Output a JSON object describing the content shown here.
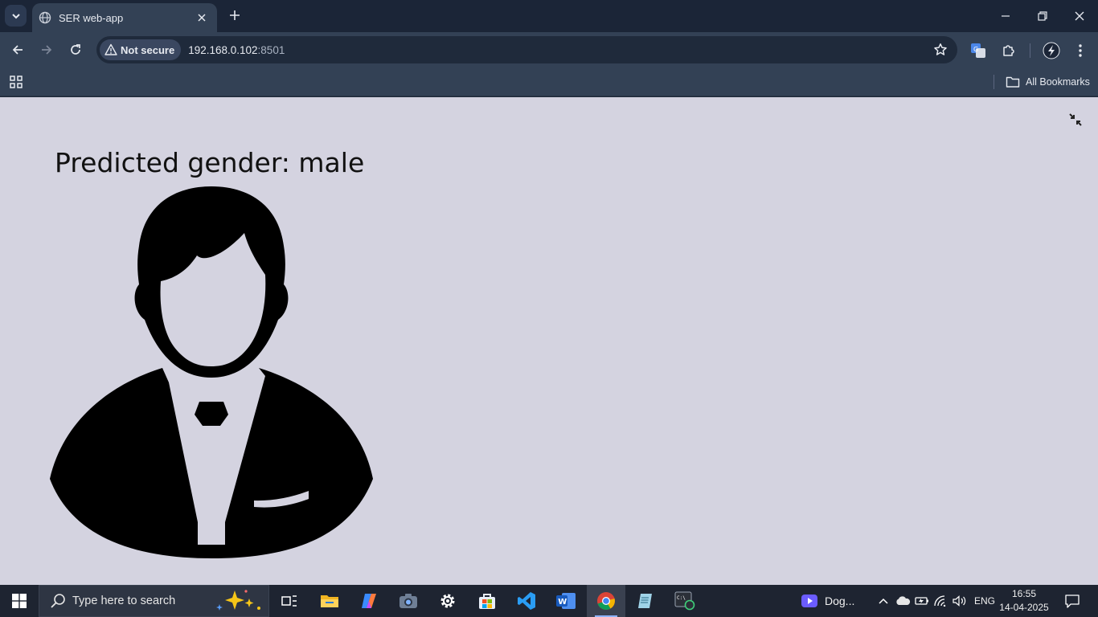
{
  "browser": {
    "tab": {
      "title": "SER web-app"
    },
    "address_bar": {
      "security_label": "Not secure",
      "host": "192.168.0.102",
      "port": ":8501"
    },
    "bookmarks_bar": {
      "all_bookmarks_label": "All Bookmarks"
    }
  },
  "page": {
    "title": "Predicted gender: male",
    "image_icon": "male-businessman-icon"
  },
  "taskbar": {
    "search_placeholder": "Type here to search",
    "apps": [
      "task-view",
      "file-explorer",
      "copilot",
      "camera",
      "settings",
      "microsoft-store",
      "vs-code",
      "word",
      "chrome",
      "notepad",
      "terminal"
    ],
    "active_app": "chrome",
    "media_label": "Dog...",
    "language": "ENG",
    "time": "16:55",
    "date": "14-04-2025"
  },
  "colors": {
    "page_background": "#d4d3e0",
    "browser_frame": "#1b2537",
    "toolbar": "#334155",
    "taskbar": "#1e2431"
  }
}
